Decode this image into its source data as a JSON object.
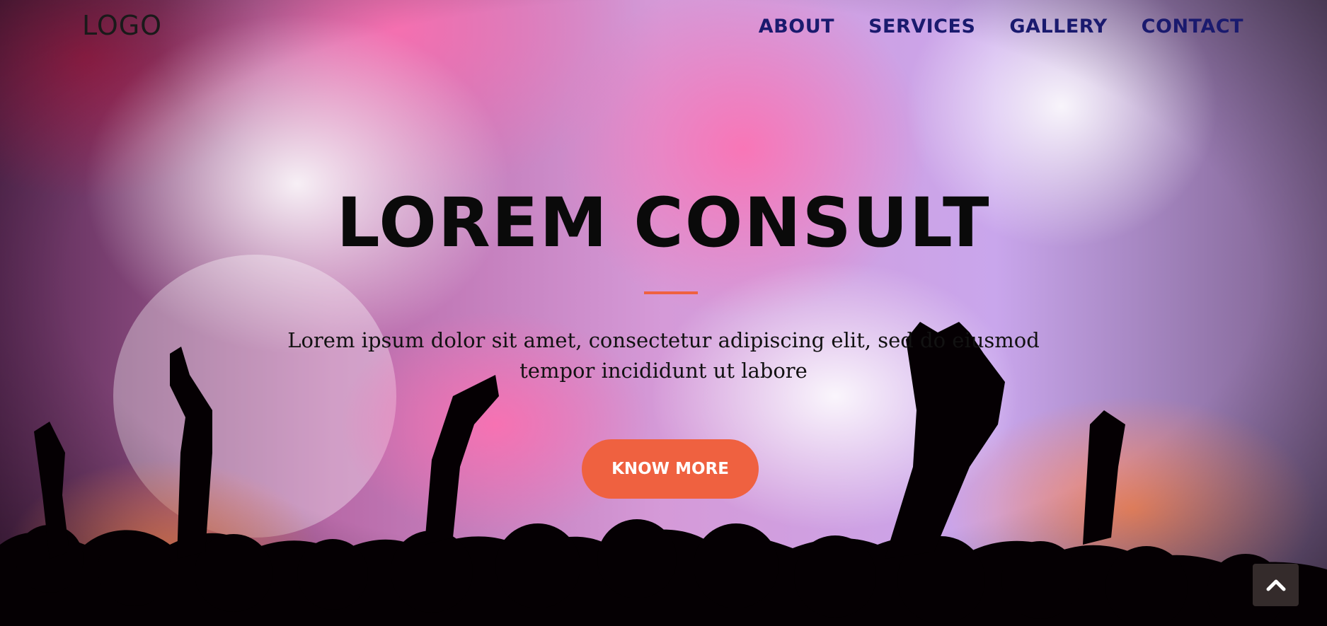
{
  "header": {
    "logo_text": "LOGO",
    "nav": [
      {
        "label": "ABOUT"
      },
      {
        "label": "SERVICES"
      },
      {
        "label": "GALLERY"
      },
      {
        "label": "CONTACT"
      }
    ]
  },
  "hero": {
    "title": "LOREM CONSULT",
    "subtitle_line1": "Lorem ipsum dolor sit amet, consectetur adipiscing elit, sed do eiusmod",
    "subtitle_line2": "tempor incididunt ut labore",
    "cta_label": "KNOW MORE"
  },
  "icons": {
    "scroll_top": "chevron-up-icon"
  },
  "colors": {
    "accent": "#ef6140",
    "nav_text": "#1a1a6e",
    "title_text": "#0a0a0a"
  }
}
